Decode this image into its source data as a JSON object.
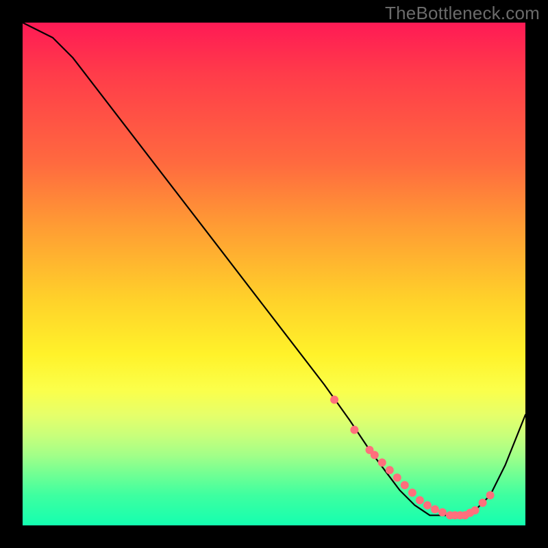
{
  "watermark": "TheBottleneck.com",
  "colors": {
    "frame_bg": "#000000",
    "gradient_top": "#ff1a55",
    "gradient_mid1": "#ff9a34",
    "gradient_mid2": "#fff22a",
    "gradient_bottom": "#14ffb0",
    "curve": "#000000",
    "dot": "#ff6f7c"
  },
  "chart_data": {
    "type": "line",
    "title": "",
    "xlabel": "",
    "ylabel": "",
    "xlim": [
      0,
      100
    ],
    "ylim": [
      0,
      100
    ],
    "x": [
      0,
      6,
      10,
      20,
      30,
      40,
      50,
      60,
      65,
      69,
      72,
      75,
      78,
      81,
      84,
      86,
      88,
      90,
      93,
      96,
      100
    ],
    "values": [
      100,
      97,
      93,
      80,
      67,
      54,
      41,
      28,
      21,
      15,
      11,
      7,
      4,
      2,
      2,
      2,
      2,
      3,
      6,
      12,
      22
    ],
    "annotations": {
      "dots_x": [
        62,
        66,
        69,
        70,
        71.5,
        73,
        74.5,
        76,
        77.5,
        79,
        80.5,
        82,
        83.5,
        85,
        86,
        87,
        88,
        89,
        90,
        91.5,
        93
      ],
      "dots_y": [
        25,
        19,
        15,
        14,
        12.5,
        11,
        9.5,
        8,
        6.5,
        5,
        4,
        3.2,
        2.6,
        2,
        2,
        2,
        2,
        2.5,
        3,
        4.5,
        6
      ]
    }
  }
}
